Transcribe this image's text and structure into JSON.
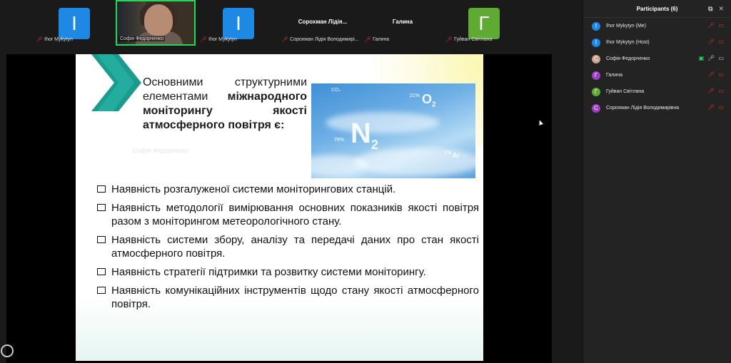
{
  "gallery": {
    "tiles": [
      {
        "initial": "І",
        "color": "#1e88e5",
        "label": "Ihor Mykytyn"
      },
      {
        "label": "Софія Федорченко"
      },
      {
        "initial": "І",
        "color": "#1e88e5",
        "label": "Ihor Mykytyn"
      },
      {
        "name": "Сорохман  Лідія...",
        "label": "Сорохман Лідія Володимирі..."
      },
      {
        "name": "Галина",
        "label": "Галина"
      },
      {
        "initial": "Г",
        "color": "#5eaa32",
        "label": "Гуйван Світлана"
      }
    ]
  },
  "slide": {
    "title_plain": "Основними структурними елементами ",
    "title_bold": "міжнародного моніторингу якості атмосферного повітря є:",
    "watermark": "Софія Федорченко",
    "sky_labels": {
      "n2": "N",
      "n2_sub": "2",
      "o2": "O",
      "o2_sub": "2",
      "ar": "Ar",
      "co2": "CO₂",
      "pct_78": "78%",
      "pct_21": "21%",
      "pct_1": "1%"
    },
    "bullets": [
      "Наявність   розгалуженої системи  моніторингових станцій.",
      "Наявність методології вимірювання основних показників якості повітря разом з моніторингом  метеорологічного стану.",
      "Наявність системи збору, аналізу та передачі  даних про стан якості атмосферного повітря.",
      "Наявність   стратегії   підтримки   та   розвитку     системи моніторингу.",
      "Наявність комунікаційних інструментів щодо   стану якості атмосферного повітря."
    ]
  },
  "panel": {
    "title": "Participants (6)",
    "participants": [
      {
        "initial": "І",
        "color": "#1e88e5",
        "name": "Ihor Mykytyn (Me)"
      },
      {
        "initial": "І",
        "color": "#1e88e5",
        "name": "Ihor Mykytyn (Host)"
      },
      {
        "initial": "С",
        "color": "#c9a38c",
        "name": "Софія Федорченко"
      },
      {
        "initial": "Г",
        "color": "#9c3fc4",
        "name": "Галина"
      },
      {
        "initial": "Г",
        "color": "#5eaa32",
        "name": "Гуйван Світлана"
      },
      {
        "initial": "С",
        "color": "#9c3fc4",
        "name": "Сорохман Лідія Володимирівна"
      }
    ]
  }
}
